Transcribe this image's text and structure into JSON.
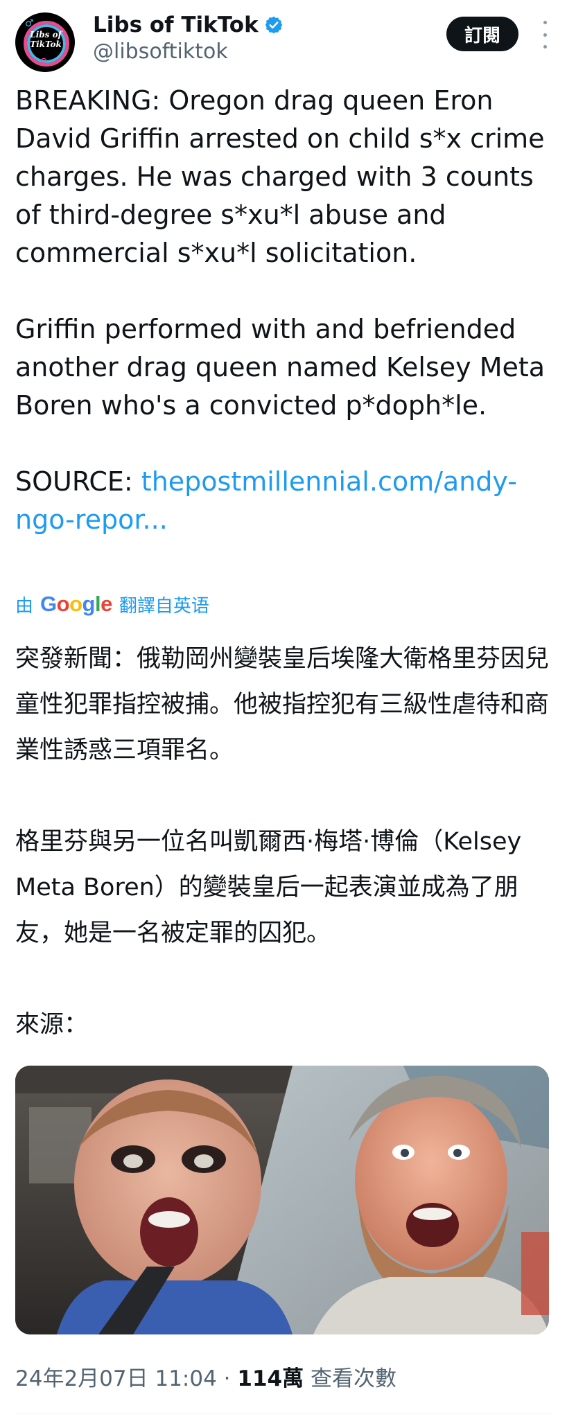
{
  "author": {
    "display_name": "Libs of TikTok",
    "handle": "@libsoftiktok",
    "avatar_text": "Libs of TikTok",
    "verified_color": "#1d9bf0"
  },
  "actions": {
    "subscribe_label": "訂閱",
    "more_icon": "more-vertical-icon"
  },
  "tweet": {
    "paragraph1": "BREAKING: Oregon drag queen Eron David Griffin arrested on child s*x crime charges. He was charged with 3 counts of third-degree s*xu*l abuse and commercial s*xu*l solicitation.",
    "paragraph2": "Griffin performed with and befriended another drag queen named Kelsey Meta Boren who's a convicted p*doph*le.",
    "source_label": "SOURCE:",
    "source_link": "thepostmillennial.com/andy-ngo-repor..."
  },
  "translation_bar": {
    "prefix": "由",
    "brand": "Google",
    "suffix": "翻譯自英语"
  },
  "translated": {
    "paragraph1": "突發新聞：俄勒岡州變裝皇后埃隆大衛格里芬因兒童性犯罪指控被捕。他被指控犯有三級性虐待和商業性誘惑三項罪名。",
    "paragraph2": "格里芬與另一位名叫凱爾西·梅塔·博倫（Kelsey Meta Boren）的變裝皇后一起表演並成為了朋友，她是一名被定罪的囚犯。",
    "source_label": "來源："
  },
  "meta": {
    "timestamp": "24年2月07日 11:04",
    "separator": "·",
    "views_count": "114萬",
    "views_label": "查看次數"
  }
}
